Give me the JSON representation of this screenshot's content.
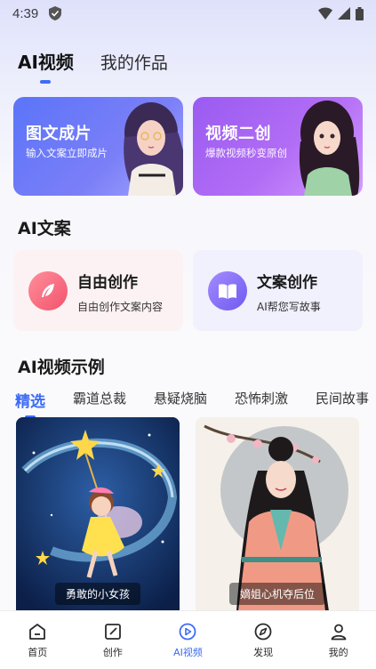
{
  "status_bar": {
    "time": "4:39"
  },
  "top_tabs": [
    {
      "label": "AI视频",
      "active": true
    },
    {
      "label": "我的作品",
      "active": false
    }
  ],
  "hero_cards": [
    {
      "title": "图文成片",
      "subtitle": "输入文案立即成片"
    },
    {
      "title": "视频二创",
      "subtitle": "爆款视频秒变原创"
    }
  ],
  "copywriting": {
    "section_title": "AI文案",
    "cards": [
      {
        "title": "自由创作",
        "subtitle": "自由创作文案内容",
        "icon": "feather-icon"
      },
      {
        "title": "文案创作",
        "subtitle": "AI帮您写故事",
        "icon": "book-icon"
      }
    ]
  },
  "examples": {
    "section_title": "AI视频示例",
    "categories": [
      {
        "label": "精选",
        "active": true
      },
      {
        "label": "霸道总裁"
      },
      {
        "label": "悬疑烧脑"
      },
      {
        "label": "恐怖刺激"
      },
      {
        "label": "民间故事"
      }
    ],
    "items": [
      {
        "caption": "勇敢的小女孩"
      },
      {
        "caption": "嫡姐心机夺后位"
      }
    ]
  },
  "bottom_nav": [
    {
      "label": "首页",
      "icon": "home-icon"
    },
    {
      "label": "创作",
      "icon": "edit-icon"
    },
    {
      "label": "AI视频",
      "icon": "play-circle-icon",
      "active": true
    },
    {
      "label": "发现",
      "icon": "compass-icon"
    },
    {
      "label": "我的",
      "icon": "user-icon"
    }
  ],
  "colors": {
    "accent": "#3d6cf5",
    "hero_blue": "#5b74f8",
    "hero_purple": "#9a5bf1"
  }
}
